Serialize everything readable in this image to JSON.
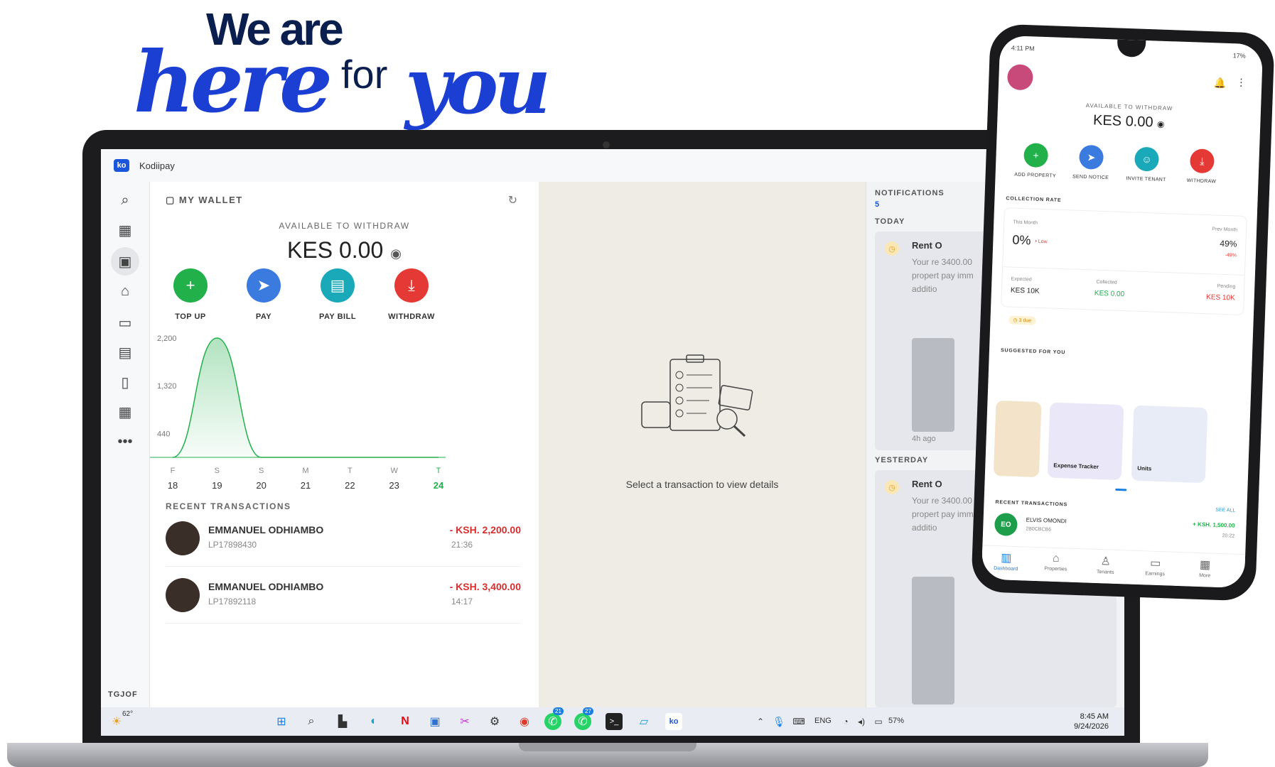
{
  "hero": {
    "line1": "We are",
    "here": "here",
    "for": "for",
    "you": "you"
  },
  "app": {
    "title": "Kodiipay",
    "logo": "ko"
  },
  "sidebar": {
    "icons": [
      "search-icon",
      "dashboard-icon",
      "wallet-icon",
      "home-icon",
      "card-icon",
      "calendar-icon",
      "document-icon",
      "grid-icon",
      "more-icon"
    ],
    "user_label": "TGJOF"
  },
  "wallet": {
    "header": "MY WALLET",
    "available_label": "AVAILABLE TO WITHDRAW",
    "balance": "KES 0.00",
    "actions": [
      {
        "label": "TOP UP",
        "color": "#22b04b",
        "glyph": "+"
      },
      {
        "label": "PAY",
        "color": "#3b7be0",
        "glyph": "➤"
      },
      {
        "label": "PAY BILL",
        "color": "#19a9b8",
        "glyph": "▤"
      },
      {
        "label": "WITHDRAW",
        "color": "#e53935",
        "glyph": "⤓"
      }
    ],
    "recent_label": "RECENT TRANSACTIONS",
    "transactions": [
      {
        "name": "EMMANUEL ODHIAMBO",
        "id": "LP17898430",
        "amount": "- KSH. 2,200.00",
        "time": "21:36"
      },
      {
        "name": "EMMANUEL ODHIAMBO",
        "id": "LP17892118",
        "amount": "- KSH. 3,400.00",
        "time": "14:17"
      }
    ]
  },
  "chart_data": {
    "type": "area",
    "categories": [
      "F 18",
      "S 19",
      "S 20",
      "M 21",
      "T 22",
      "W 23",
      "T 24"
    ],
    "days": [
      "F",
      "S",
      "S",
      "M",
      "T",
      "W",
      "T"
    ],
    "dates": [
      "18",
      "19",
      "20",
      "21",
      "22",
      "23",
      "24"
    ],
    "values": [
      0,
      2200,
      0,
      0,
      0,
      0,
      0
    ],
    "ytick_labels": [
      "2,200",
      "1,320",
      "440"
    ],
    "ylim": [
      0,
      2200
    ],
    "highlight_color": "#22b04b",
    "grid": false
  },
  "detail": {
    "message": "Select a transaction to view details"
  },
  "notifications": {
    "header": "NOTIFICATIONS",
    "count": "5",
    "today": "TODAY",
    "yesterday": "YESTERDAY",
    "items": [
      {
        "title": "Rent O",
        "body": "Your re 3400.00 propert pay imm additio",
        "time": "4h ago"
      },
      {
        "title": "Rent O",
        "body": "Your re 3400.00 propert pay imm additio"
      }
    ]
  },
  "taskbar": {
    "weather": "62°",
    "badges": [
      "21",
      "27"
    ],
    "lang": "ENG",
    "battery": "57%",
    "time": "8:45 AM",
    "date": "9/24/2026"
  },
  "phone": {
    "status_time": "4:11 PM",
    "battery": "17%",
    "available_label": "AVAILABLE TO WITHDRAW",
    "balance": "KES 0.00",
    "actions": [
      {
        "label": "ADD PROPERTY",
        "color": "#22b04b",
        "glyph": "+"
      },
      {
        "label": "SEND NOTICE",
        "color": "#3b7be0",
        "glyph": "➤"
      },
      {
        "label": "INVITE TENANT",
        "color": "#19a9b8",
        "glyph": "☺"
      },
      {
        "label": "WITHDRAW",
        "color": "#e53935",
        "glyph": "⤓"
      }
    ],
    "collection": {
      "title": "COLLECTION RATE",
      "this_month_label": "This Month",
      "this_month": "0%",
      "this_month_tag": "• Low",
      "prev_month_label": "Prev Month",
      "prev_month": "49%",
      "prev_change": "-49%",
      "expected_label": "Expected",
      "expected": "KES 10K",
      "collected_label": "Collected",
      "collected": "KES 0.00",
      "pending_label": "Pending",
      "pending": "KES 10K",
      "due": "3 due"
    },
    "suggested_label": "SUGGESTED FOR YOU",
    "suggested": [
      "Expense Tracker",
      "Units"
    ],
    "recent_label": "RECENT TRANSACTIONS",
    "see_all": "SEE ALL",
    "tx": {
      "initials": "EO",
      "name": "ELVIS OMONDI",
      "ref": "2B0CBCB6",
      "amount": "+ KSH. 1,500.00",
      "time": "20:22"
    },
    "nav": [
      "Dashboard",
      "Properties",
      "Tenants",
      "Earnings",
      "More"
    ]
  }
}
